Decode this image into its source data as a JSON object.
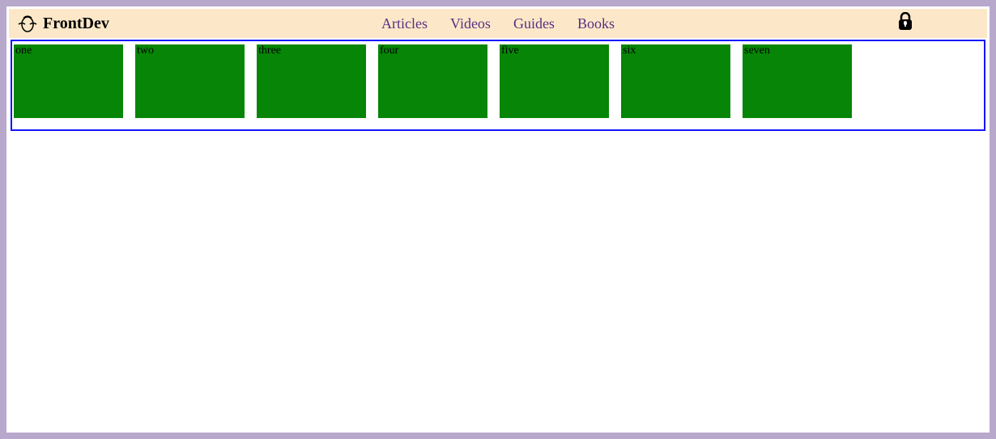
{
  "header": {
    "brand": "FrontDev",
    "nav": [
      "Articles",
      "Videos",
      "Guides",
      "Books"
    ]
  },
  "grid": {
    "items": [
      "one",
      "two",
      "three",
      "four",
      "five",
      "six",
      "seven"
    ]
  }
}
